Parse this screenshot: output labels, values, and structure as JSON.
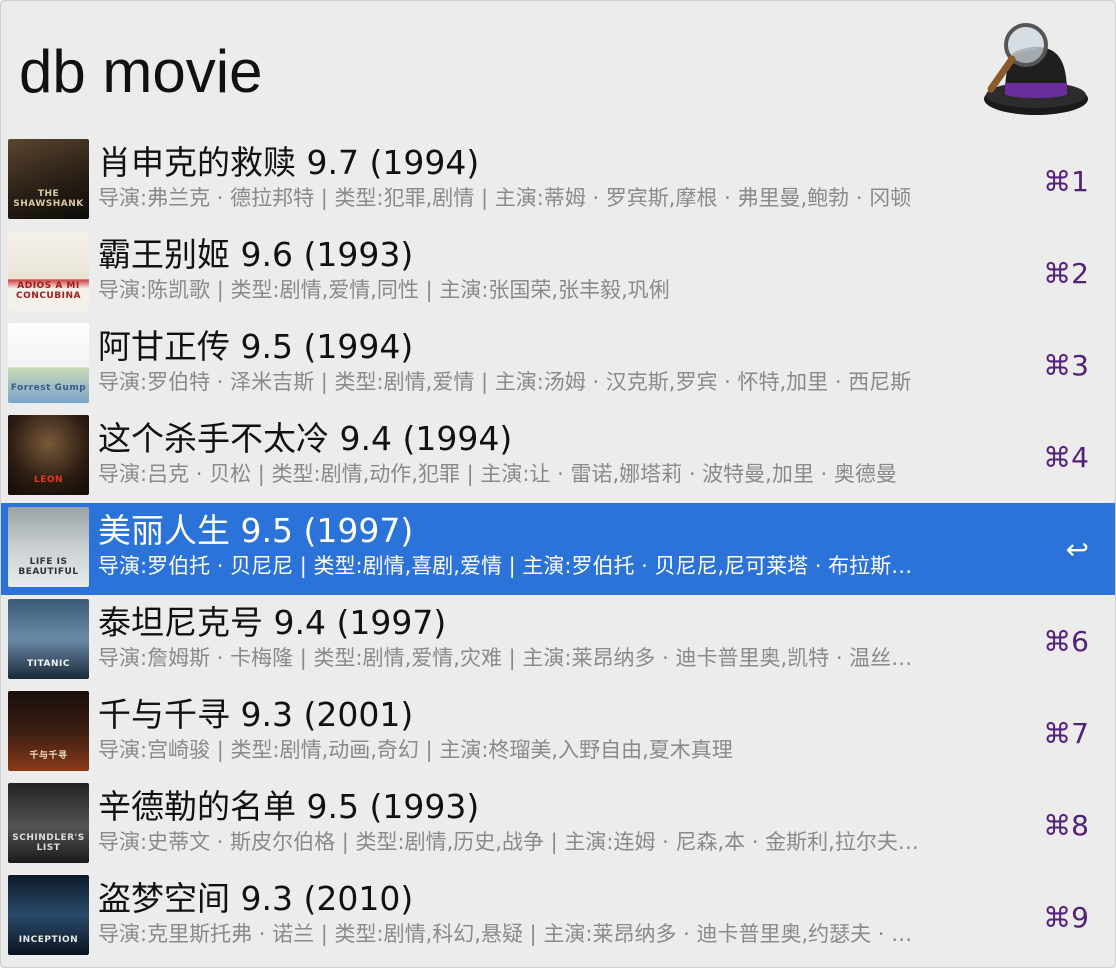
{
  "search": {
    "query": "db movie"
  },
  "app": {
    "logo_icon": "alfred-hat-icon"
  },
  "colors": {
    "selection": "#2b73d8",
    "shortcut": "#53207a",
    "subtitle": "#8a8a8a"
  },
  "results": [
    {
      "title": "肖申克的救赎 9.7 (1994)",
      "subtitle": "导演:弗兰克 · 德拉邦特 | 类型:犯罪,剧情 | 主演:蒂姆 · 罗宾斯,摩根 · 弗里曼,鲍勃 · 冈顿",
      "shortcut": "⌘1",
      "poster_label": "THE SHAWSHANK",
      "poster_icon": "shawshank-poster-icon"
    },
    {
      "title": "霸王别姬 9.6 (1993)",
      "subtitle": "导演:陈凯歌 | 类型:剧情,爱情,同性 | 主演:张国荣,张丰毅,巩俐",
      "shortcut": "⌘2",
      "poster_label": "ADIOS A MI CONCUBINA",
      "poster_icon": "farewell-poster-icon"
    },
    {
      "title": "阿甘正传 9.5 (1994)",
      "subtitle": "导演:罗伯特 · 泽米吉斯 | 类型:剧情,爱情 | 主演:汤姆 · 汉克斯,罗宾 · 怀特,加里 · 西尼斯",
      "shortcut": "⌘3",
      "poster_label": "Forrest Gump",
      "poster_icon": "forrest-gump-poster-icon"
    },
    {
      "title": "这个杀手不太冷 9.4 (1994)",
      "subtitle": "导演:吕克 · 贝松 | 类型:剧情,动作,犯罪 | 主演:让 · 雷诺,娜塔莉 · 波特曼,加里 · 奥德曼",
      "shortcut": "⌘4",
      "poster_label": "LEON",
      "poster_icon": "leon-poster-icon"
    },
    {
      "title": "美丽人生 9.5 (1997)",
      "subtitle": "导演:罗伯托 · 贝尼尼 | 类型:剧情,喜剧,爱情 | 主演:罗伯托 · 贝尼尼,尼可莱塔 · 布拉斯…",
      "shortcut": "↩",
      "poster_label": "LIFE IS BEAUTIFUL",
      "poster_icon": "life-is-beautiful-poster-icon",
      "selected": true
    },
    {
      "title": "泰坦尼克号 9.4 (1997)",
      "subtitle": "导演:詹姆斯 · 卡梅隆 | 类型:剧情,爱情,灾难 | 主演:莱昂纳多 · 迪卡普里奥,凯特 · 温丝…",
      "shortcut": "⌘6",
      "poster_label": "TITANIC",
      "poster_icon": "titanic-poster-icon"
    },
    {
      "title": "千与千寻 9.3 (2001)",
      "subtitle": "导演:宫崎骏 | 类型:剧情,动画,奇幻 | 主演:柊瑠美,入野自由,夏木真理",
      "shortcut": "⌘7",
      "poster_label": "千与千寻",
      "poster_icon": "spirited-away-poster-icon"
    },
    {
      "title": "辛德勒的名单 9.5 (1993)",
      "subtitle": "导演:史蒂文 · 斯皮尔伯格 | 类型:剧情,历史,战争 | 主演:连姆 · 尼森,本 · 金斯利,拉尔夫…",
      "shortcut": "⌘8",
      "poster_label": "SCHINDLER'S LIST",
      "poster_icon": "schindlers-list-poster-icon"
    },
    {
      "title": "盗梦空间 9.3 (2010)",
      "subtitle": "导演:克里斯托弗 · 诺兰 | 类型:剧情,科幻,悬疑 | 主演:莱昂纳多 · 迪卡普里奥,约瑟夫 · …",
      "shortcut": "⌘9",
      "poster_label": "INCEPTION",
      "poster_icon": "inception-poster-icon"
    }
  ]
}
